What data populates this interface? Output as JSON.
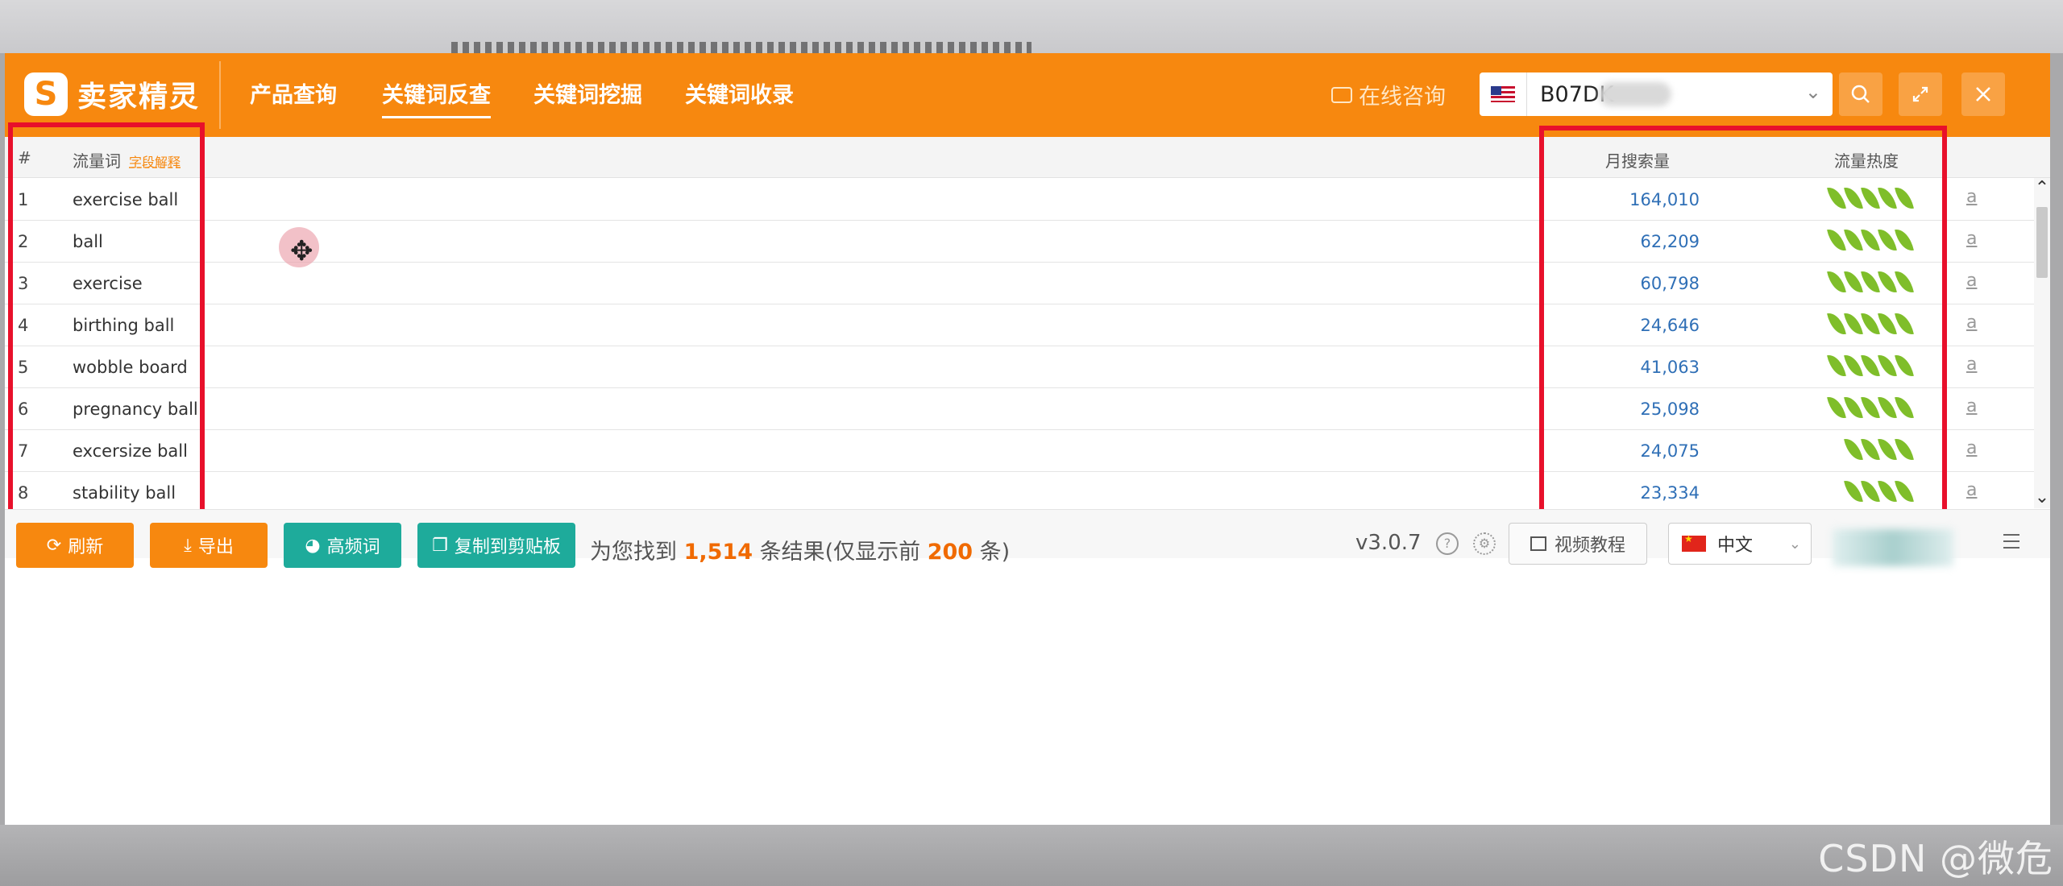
{
  "header": {
    "logo_text": "卖家精灵",
    "nav": [
      "产品查询",
      "关键词反查",
      "关键词挖掘",
      "关键词收录"
    ],
    "active_nav": "关键词反查",
    "consult_label": "在线咨询",
    "search": {
      "value": "B07DK",
      "marketplace": "US"
    }
  },
  "table": {
    "headers": {
      "num": "#",
      "keyword": "流量词",
      "keyword_note": "字段解释",
      "volume": "月搜索量",
      "heat": "流量热度"
    },
    "rows": [
      {
        "num": "1",
        "keyword": "exercise ball",
        "volume": "164,010",
        "heat": 5,
        "amazon": "a"
      },
      {
        "num": "2",
        "keyword": "ball",
        "volume": "62,209",
        "heat": 5,
        "amazon": "a"
      },
      {
        "num": "3",
        "keyword": "exercise",
        "volume": "60,798",
        "heat": 5,
        "amazon": "a"
      },
      {
        "num": "4",
        "keyword": "birthing ball",
        "volume": "24,646",
        "heat": 5,
        "amazon": "a"
      },
      {
        "num": "5",
        "keyword": "wobble board",
        "volume": "41,063",
        "heat": 5,
        "amazon": "a"
      },
      {
        "num": "6",
        "keyword": "pregnancy ball",
        "volume": "25,098",
        "heat": 5,
        "amazon": "a"
      },
      {
        "num": "7",
        "keyword": "excersize ball",
        "volume": "24,075",
        "heat": 4,
        "amazon": "a"
      },
      {
        "num": "8",
        "keyword": "stability ball",
        "volume": "23,334",
        "heat": 4,
        "amazon": "a"
      }
    ]
  },
  "footer": {
    "buttons": {
      "refresh": "刷新",
      "export": "导出",
      "frequent": "高频词",
      "copy": "复制到剪贴板"
    },
    "result": {
      "prefix": "为您找到 ",
      "count": "1,514",
      "middle": " 条结果(仅显示前 ",
      "limit": "200",
      "suffix": " 条)"
    },
    "version": "v3.0.7",
    "video_label": "视频教程",
    "language": "中文"
  },
  "watermark": "CSDN @微危",
  "colors": {
    "brand_orange": "#f7880f",
    "teal": "#1eab9b",
    "highlight_red": "#e8102b",
    "leaf_green": "#7fbe2a",
    "link_blue": "#2f6fb6"
  }
}
